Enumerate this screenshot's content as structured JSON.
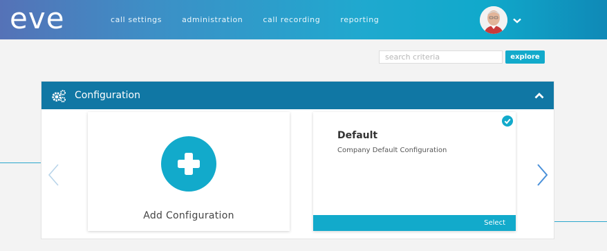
{
  "app": {
    "logo_text": "eve"
  },
  "nav": {
    "items": [
      {
        "label": "call settings"
      },
      {
        "label": "administration"
      },
      {
        "label": "call recording"
      },
      {
        "label": "reporting"
      }
    ]
  },
  "search": {
    "placeholder": "search criteria",
    "value": "",
    "button_label": "explore"
  },
  "panel": {
    "title": "Configuration",
    "cards": {
      "add": {
        "label": "Add Configuration"
      },
      "default": {
        "title": "Default",
        "description": "Company Default Configuration",
        "select_label": "Select",
        "selected": true
      }
    }
  },
  "icons": {
    "user": "user-avatar-icon",
    "menu": "chevron-down-icon",
    "panel": "gears-icon",
    "collapse": "chevron-up-icon",
    "add": "plus-icon",
    "selected": "check-circle-icon",
    "prev": "chevron-left-icon",
    "next": "chevron-right-icon"
  },
  "colors": {
    "accent": "#12aacb",
    "panel_header": "#1077a4",
    "nav_arrow": "#4a90d9",
    "nav_arrow_disabled": "#b9d5ea"
  }
}
